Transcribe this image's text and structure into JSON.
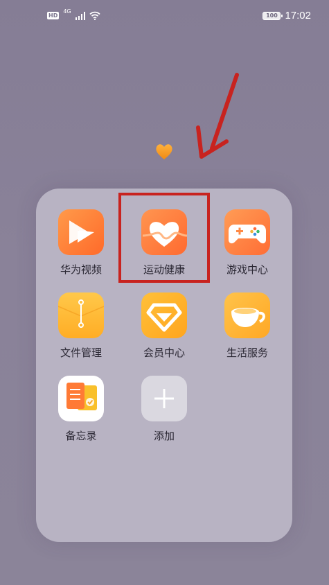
{
  "status_bar": {
    "hd": "HD",
    "network": "4G",
    "battery": "100",
    "time": "17:02"
  },
  "folder": {
    "apps": [
      {
        "label": "华为视频",
        "icon": "huawei-video-icon"
      },
      {
        "label": "运动健康",
        "icon": "health-heart-icon",
        "highlighted": true
      },
      {
        "label": "游戏中心",
        "icon": "gamepad-icon"
      },
      {
        "label": "文件管理",
        "icon": "file-folder-icon"
      },
      {
        "label": "会员中心",
        "icon": "diamond-icon"
      },
      {
        "label": "生活服务",
        "icon": "cup-icon"
      },
      {
        "label": "备忘录",
        "icon": "notes-icon"
      },
      {
        "label": "添加",
        "icon": "plus-icon"
      }
    ]
  },
  "annotation": {
    "highlight_color": "#c8231f",
    "arrow_color": "#c8231f"
  }
}
